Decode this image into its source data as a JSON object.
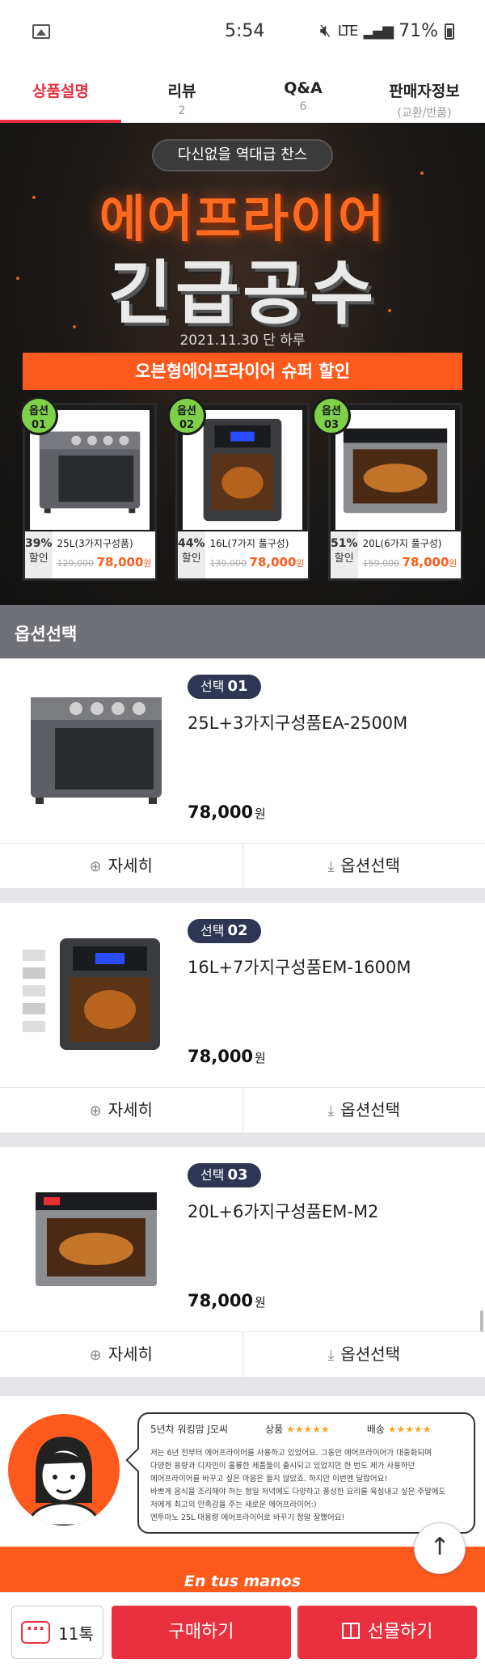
{
  "status_bar": {
    "time": "5:54",
    "network": "LTE",
    "battery": "71%"
  },
  "tabs": [
    {
      "label": "상품설명",
      "sub": ""
    },
    {
      "label": "리뷰",
      "sub": "2"
    },
    {
      "label": "Q&A",
      "sub": "6"
    },
    {
      "label": "판매자정보",
      "sub": "(교환/반품)"
    }
  ],
  "banner": {
    "pill": "다신없을 역대급 찬스",
    "title_line1": "에어프라이어",
    "title_line2": "긴급공수",
    "date": "2021.11.30 단 하루",
    "subtitle": "오븐형에어프라이어 슈퍼 할인",
    "products": [
      {
        "badge_top": "옵션",
        "badge_num": "01",
        "discount": "39%",
        "discount_label": "할인",
        "name": "25L(3가지구성품)",
        "old_price": "129,000",
        "new_price": "78,000",
        "currency": "원"
      },
      {
        "badge_top": "옵션",
        "badge_num": "02",
        "discount": "44%",
        "discount_label": "할인",
        "name": "16L(7가지 풀구성)",
        "old_price": "139,000",
        "new_price": "78,000",
        "currency": "원"
      },
      {
        "badge_top": "옵션",
        "badge_num": "03",
        "discount": "51%",
        "discount_label": "할인",
        "name": "20L(6가지 풀구성)",
        "old_price": "159,000",
        "new_price": "78,000",
        "currency": "원"
      }
    ]
  },
  "option_header": "옵션선택",
  "options": [
    {
      "chip": "선택",
      "num": "01",
      "name": "25L+3가지구성품EA-2500M",
      "price": "78,000",
      "currency": "원",
      "detail": "자세히",
      "select": "옵션선택"
    },
    {
      "chip": "선택",
      "num": "02",
      "name": "16L+7가지구성품EM-1600M",
      "price": "78,000",
      "currency": "원",
      "detail": "자세히",
      "select": "옵션선택"
    },
    {
      "chip": "선택",
      "num": "03",
      "name": "20L+6가지구성품EM-M2",
      "price": "78,000",
      "currency": "원",
      "detail": "자세히",
      "select": "옵션선택"
    }
  ],
  "review": {
    "author": "5년차 워킹맘 J모씨",
    "product_label": "상품",
    "delivery_label": "배송",
    "stars": "★★★★★",
    "lines": [
      "저는 6년 전부터 에어프라이어를 사용하고 있었어요. 그동안 에어프라이어가 대중화되며",
      "다양한 용량과 디자인이 훌륭한 제품들이 출시되고 있었지만 한 번도 제가 사용하던",
      "에어프라이어를 바꾸고 싶은 마음은 들지 않았죠. 하지만 이번엔 달랐어요!",
      "바쁘게 음식을 조리해야 하는 형일 저녁에도 다양하고 풍성한 요리를 육심내고 싶은 주말에도",
      "저에게 최고의 만족감을 주는 새로운 에어프라이어:)",
      "엔투마노 25L 대용량 에어프라이어로 바꾸기 정말 잘했어요!"
    ]
  },
  "brand": "En tus manos",
  "bottom": {
    "chat_count": "11톡",
    "chat_icon_text": "···",
    "buy": "구매하기",
    "gift": "선물하기"
  },
  "colors": {
    "accent": "#e8303f",
    "orange": "#ff5a1e",
    "chip": "#2f3653",
    "badge": "#7fd14a"
  }
}
